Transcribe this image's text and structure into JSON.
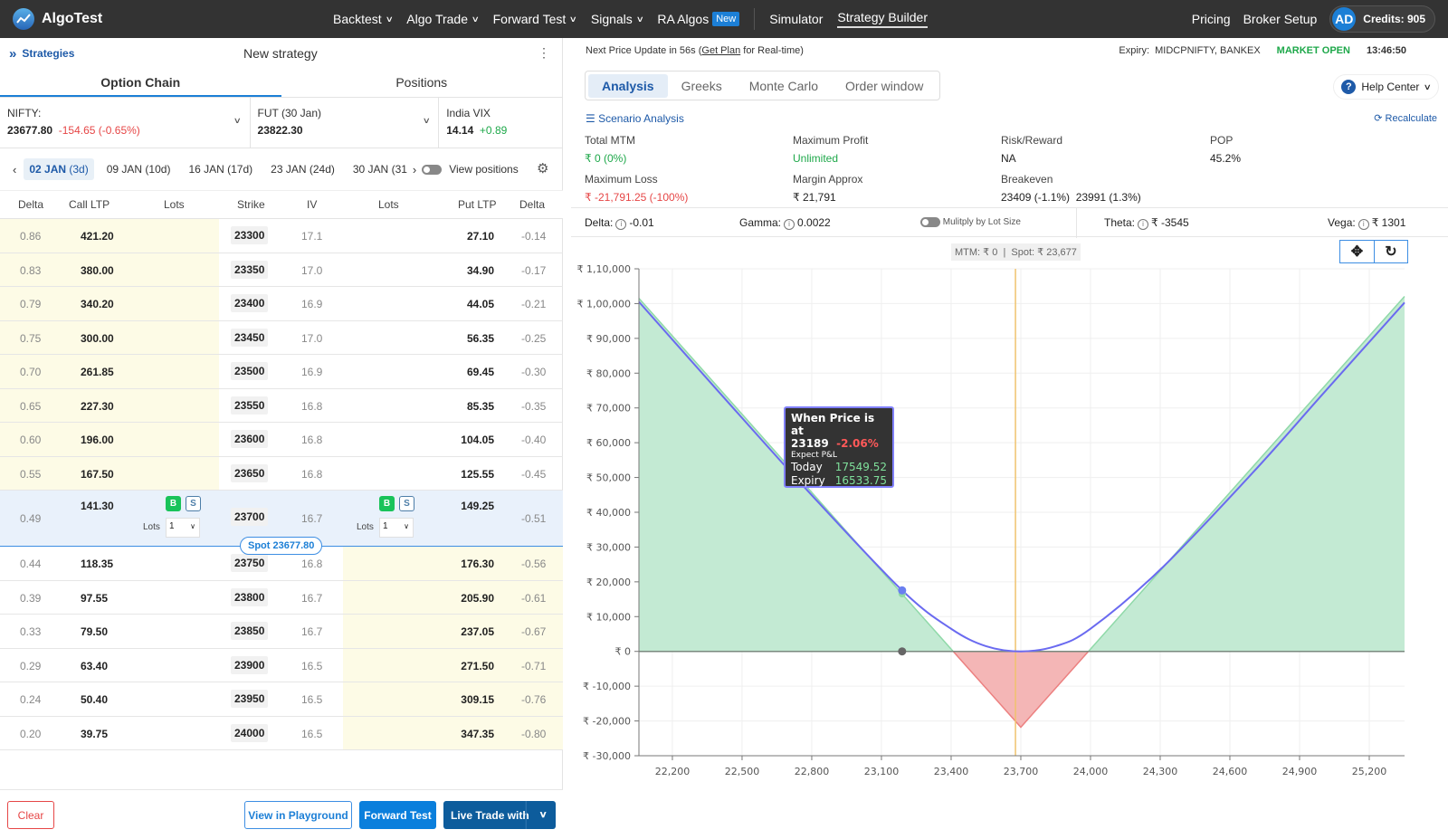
{
  "topbar": {
    "brand": "AlgoTest",
    "nav": [
      {
        "label": "Backtest",
        "dropdown": true
      },
      {
        "label": "Algo Trade",
        "dropdown": true
      },
      {
        "label": "Forward Test",
        "dropdown": true
      },
      {
        "label": "Signals",
        "dropdown": true
      },
      {
        "label": "RA Algos",
        "badge": "New"
      },
      {
        "label": "Simulator"
      },
      {
        "label": "Strategy Builder",
        "active": true
      }
    ],
    "pricing": "Pricing",
    "broker_setup": "Broker Setup",
    "avatar_initials": "AD",
    "credits": "Credits: 905"
  },
  "left": {
    "strategies_link": "Strategies",
    "strategy_name": "New strategy",
    "tabs": [
      "Option Chain",
      "Positions"
    ],
    "active_tab": "Option Chain",
    "tickers": {
      "nifty": {
        "label": "NIFTY:",
        "value": "23677.80",
        "change": "-154.65 (-0.65%)"
      },
      "fut": {
        "label": "FUT (30 Jan)",
        "value": "23822.30"
      },
      "vix": {
        "label": "India VIX",
        "value": "14.14",
        "change": "+0.89"
      }
    },
    "expiries": [
      {
        "date": "02 JAN",
        "days": "(3d)",
        "active": true
      },
      {
        "date": "09 JAN",
        "days": "(10d)"
      },
      {
        "date": "16 JAN",
        "days": "(17d)"
      },
      {
        "date": "23 JAN",
        "days": "(24d)"
      },
      {
        "date": "30 JAN",
        "days": "(31d"
      }
    ],
    "view_positions": "View positions",
    "columns": [
      "Delta",
      "Call LTP",
      "Lots",
      "Strike",
      "IV",
      "Lots",
      "Put LTP",
      "Delta"
    ],
    "rows": [
      {
        "call_delta": "0.86",
        "call_ltp": "421.20",
        "strike": "23300",
        "iv": "17.1",
        "put_ltp": "27.10",
        "put_delta": "-0.14"
      },
      {
        "call_delta": "0.83",
        "call_ltp": "380.00",
        "strike": "23350",
        "iv": "17.0",
        "put_ltp": "34.90",
        "put_delta": "-0.17"
      },
      {
        "call_delta": "0.79",
        "call_ltp": "340.20",
        "strike": "23400",
        "iv": "16.9",
        "put_ltp": "44.05",
        "put_delta": "-0.21"
      },
      {
        "call_delta": "0.75",
        "call_ltp": "300.00",
        "strike": "23450",
        "iv": "17.0",
        "put_ltp": "56.35",
        "put_delta": "-0.25"
      },
      {
        "call_delta": "0.70",
        "call_ltp": "261.85",
        "strike": "23500",
        "iv": "16.9",
        "put_ltp": "69.45",
        "put_delta": "-0.30"
      },
      {
        "call_delta": "0.65",
        "call_ltp": "227.30",
        "strike": "23550",
        "iv": "16.8",
        "put_ltp": "85.35",
        "put_delta": "-0.35"
      },
      {
        "call_delta": "0.60",
        "call_ltp": "196.00",
        "strike": "23600",
        "iv": "16.8",
        "put_ltp": "104.05",
        "put_delta": "-0.40"
      },
      {
        "call_delta": "0.55",
        "call_ltp": "167.50",
        "strike": "23650",
        "iv": "16.8",
        "put_ltp": "125.55",
        "put_delta": "-0.45"
      },
      {
        "call_delta": "0.49",
        "call_ltp": "141.30",
        "strike": "23700",
        "iv": "16.7",
        "put_ltp": "149.25",
        "put_delta": "-0.51",
        "atm": true
      },
      {
        "call_delta": "0.44",
        "call_ltp": "118.35",
        "strike": "23750",
        "iv": "16.8",
        "put_ltp": "176.30",
        "put_delta": "-0.56"
      },
      {
        "call_delta": "0.39",
        "call_ltp": "97.55",
        "strike": "23800",
        "iv": "16.7",
        "put_ltp": "205.90",
        "put_delta": "-0.61"
      },
      {
        "call_delta": "0.33",
        "call_ltp": "79.50",
        "strike": "23850",
        "iv": "16.7",
        "put_ltp": "237.05",
        "put_delta": "-0.67"
      },
      {
        "call_delta": "0.29",
        "call_ltp": "63.40",
        "strike": "23900",
        "iv": "16.5",
        "put_ltp": "271.50",
        "put_delta": "-0.71"
      },
      {
        "call_delta": "0.24",
        "call_ltp": "50.40",
        "strike": "23950",
        "iv": "16.5",
        "put_ltp": "309.15",
        "put_delta": "-0.76"
      },
      {
        "call_delta": "0.20",
        "call_ltp": "39.75",
        "strike": "24000",
        "iv": "16.5",
        "put_ltp": "347.35",
        "put_delta": "-0.80"
      }
    ],
    "atm_controls": {
      "buy": "B",
      "sell": "S",
      "lots_label": "Lots",
      "lots_value": "1"
    },
    "spot_label": "Spot 23677.80",
    "footer": {
      "clear": "Clear",
      "playground": "View in Playground",
      "forward_test": "Forward Test",
      "live_trade": "Live Trade with"
    }
  },
  "right": {
    "price_update": {
      "prefix": "Next Price Update in 56s (",
      "link": "Get Plan",
      "suffix": " for Real-time)"
    },
    "expiry_info": "Expiry:  MIDCPNIFTY, BANKEX",
    "market_status": "MARKET OPEN",
    "clock": "13:46:50",
    "analysis_tabs": [
      "Analysis",
      "Greeks",
      "Monte Carlo",
      "Order window"
    ],
    "active_analysis_tab": "Analysis",
    "help_center": "Help Center",
    "scenario_analysis": "Scenario Analysis",
    "recalculate": "Recalculate",
    "stats": {
      "total_mtm": {
        "label": "Total MTM",
        "value": "₹ 0 (0%)"
      },
      "max_profit": {
        "label": "Maximum Profit",
        "value": "Unlimited"
      },
      "risk_reward": {
        "label": "Risk/Reward",
        "value": "NA"
      },
      "pop": {
        "label": "POP",
        "value": "45.2%"
      },
      "max_loss": {
        "label": "Maximum Loss",
        "value": "₹ -21,791.25 (-100%)"
      },
      "margin": {
        "label": "Margin Approx",
        "value": "₹ 21,791"
      },
      "breakeven": {
        "label": "Breakeven",
        "value": "23409 (-1.1%)  23991 (1.3%)"
      }
    },
    "greeks": {
      "delta": {
        "label": "Delta:",
        "value": "-0.01"
      },
      "gamma": {
        "label": "Gamma:",
        "value": "0.0022"
      },
      "multiply": "Mulitply by Lot Size",
      "theta": {
        "label": "Theta:",
        "value": "₹ -3545"
      },
      "vega": {
        "label": "Vega:",
        "value": "₹ 1301"
      }
    },
    "mtm_spot_label": "MTM: ₹ 0  |  Spot: ₹ 23,677",
    "tooltip": {
      "title": "When Price is at",
      "price": "23189",
      "pct": "-2.06%",
      "subtitle": "Expect P&L",
      "today_label": "Today",
      "today_value": "17549.52",
      "expiry_label": "Expiry",
      "expiry_value": "16533.75"
    }
  },
  "colors": {
    "accent": "#1c7fd6",
    "profit_fill": "#c3ead3",
    "loss_fill": "#f4b6b6",
    "today_line": "#6a6af0",
    "spot_line": "#f0c36e",
    "positive": "#1ea84a",
    "negative": "#e64646"
  },
  "chart_data": {
    "type": "area",
    "title": "",
    "xlabel": "",
    "ylabel": "",
    "xlim": [
      22056,
      25352
    ],
    "ylim": [
      -30000,
      110000
    ],
    "x_ticks": [
      22200,
      22500,
      22800,
      23100,
      23400,
      23700,
      24000,
      24300,
      24600,
      24900,
      25200
    ],
    "x_tick_labels": [
      "22,200",
      "22,500",
      "22,800",
      "23,100",
      "23,400",
      "23,700",
      "24,000",
      "24,300",
      "24,600",
      "24,900",
      "25,200"
    ],
    "y_ticks": [
      110000,
      100000,
      90000,
      80000,
      70000,
      60000,
      50000,
      40000,
      30000,
      20000,
      10000,
      0,
      -10000,
      -20000,
      -30000
    ],
    "y_tick_labels": [
      "₹ 1,10,000",
      "₹ 1,00,000",
      "₹ 90,000",
      "₹ 80,000",
      "₹ 70,000",
      "₹ 60,000",
      "₹ 50,000",
      "₹ 40,000",
      "₹ 30,000",
      "₹ 20,000",
      "₹ 10,000",
      "₹ 0",
      "₹ -10,000",
      "₹ -20,000",
      "₹ -30,000"
    ],
    "grid": true,
    "spot": 23677,
    "series": [
      {
        "name": "Expiry P&L",
        "x": [
          22056,
          23409,
          23700,
          23991,
          25352
        ],
        "y": [
          101509,
          0,
          -21791,
          0,
          102075
        ]
      },
      {
        "name": "Today P&L",
        "x": [
          22056,
          22400,
          22800,
          23189,
          23400,
          23550,
          23700,
          23850,
          24000,
          24300,
          24700,
          25000,
          25352
        ],
        "y": [
          100500,
          74600,
          44900,
          17549,
          6500,
          1500,
          0,
          1500,
          6500,
          23500,
          51500,
          74000,
          100300
        ]
      }
    ],
    "markers": [
      {
        "series": "Today P&L",
        "x": 23189,
        "y": 17549
      },
      {
        "series": "Expiry P&L",
        "x": 23189,
        "y": 16534
      },
      {
        "series": "axis",
        "x": 23189,
        "y": 0
      }
    ]
  }
}
